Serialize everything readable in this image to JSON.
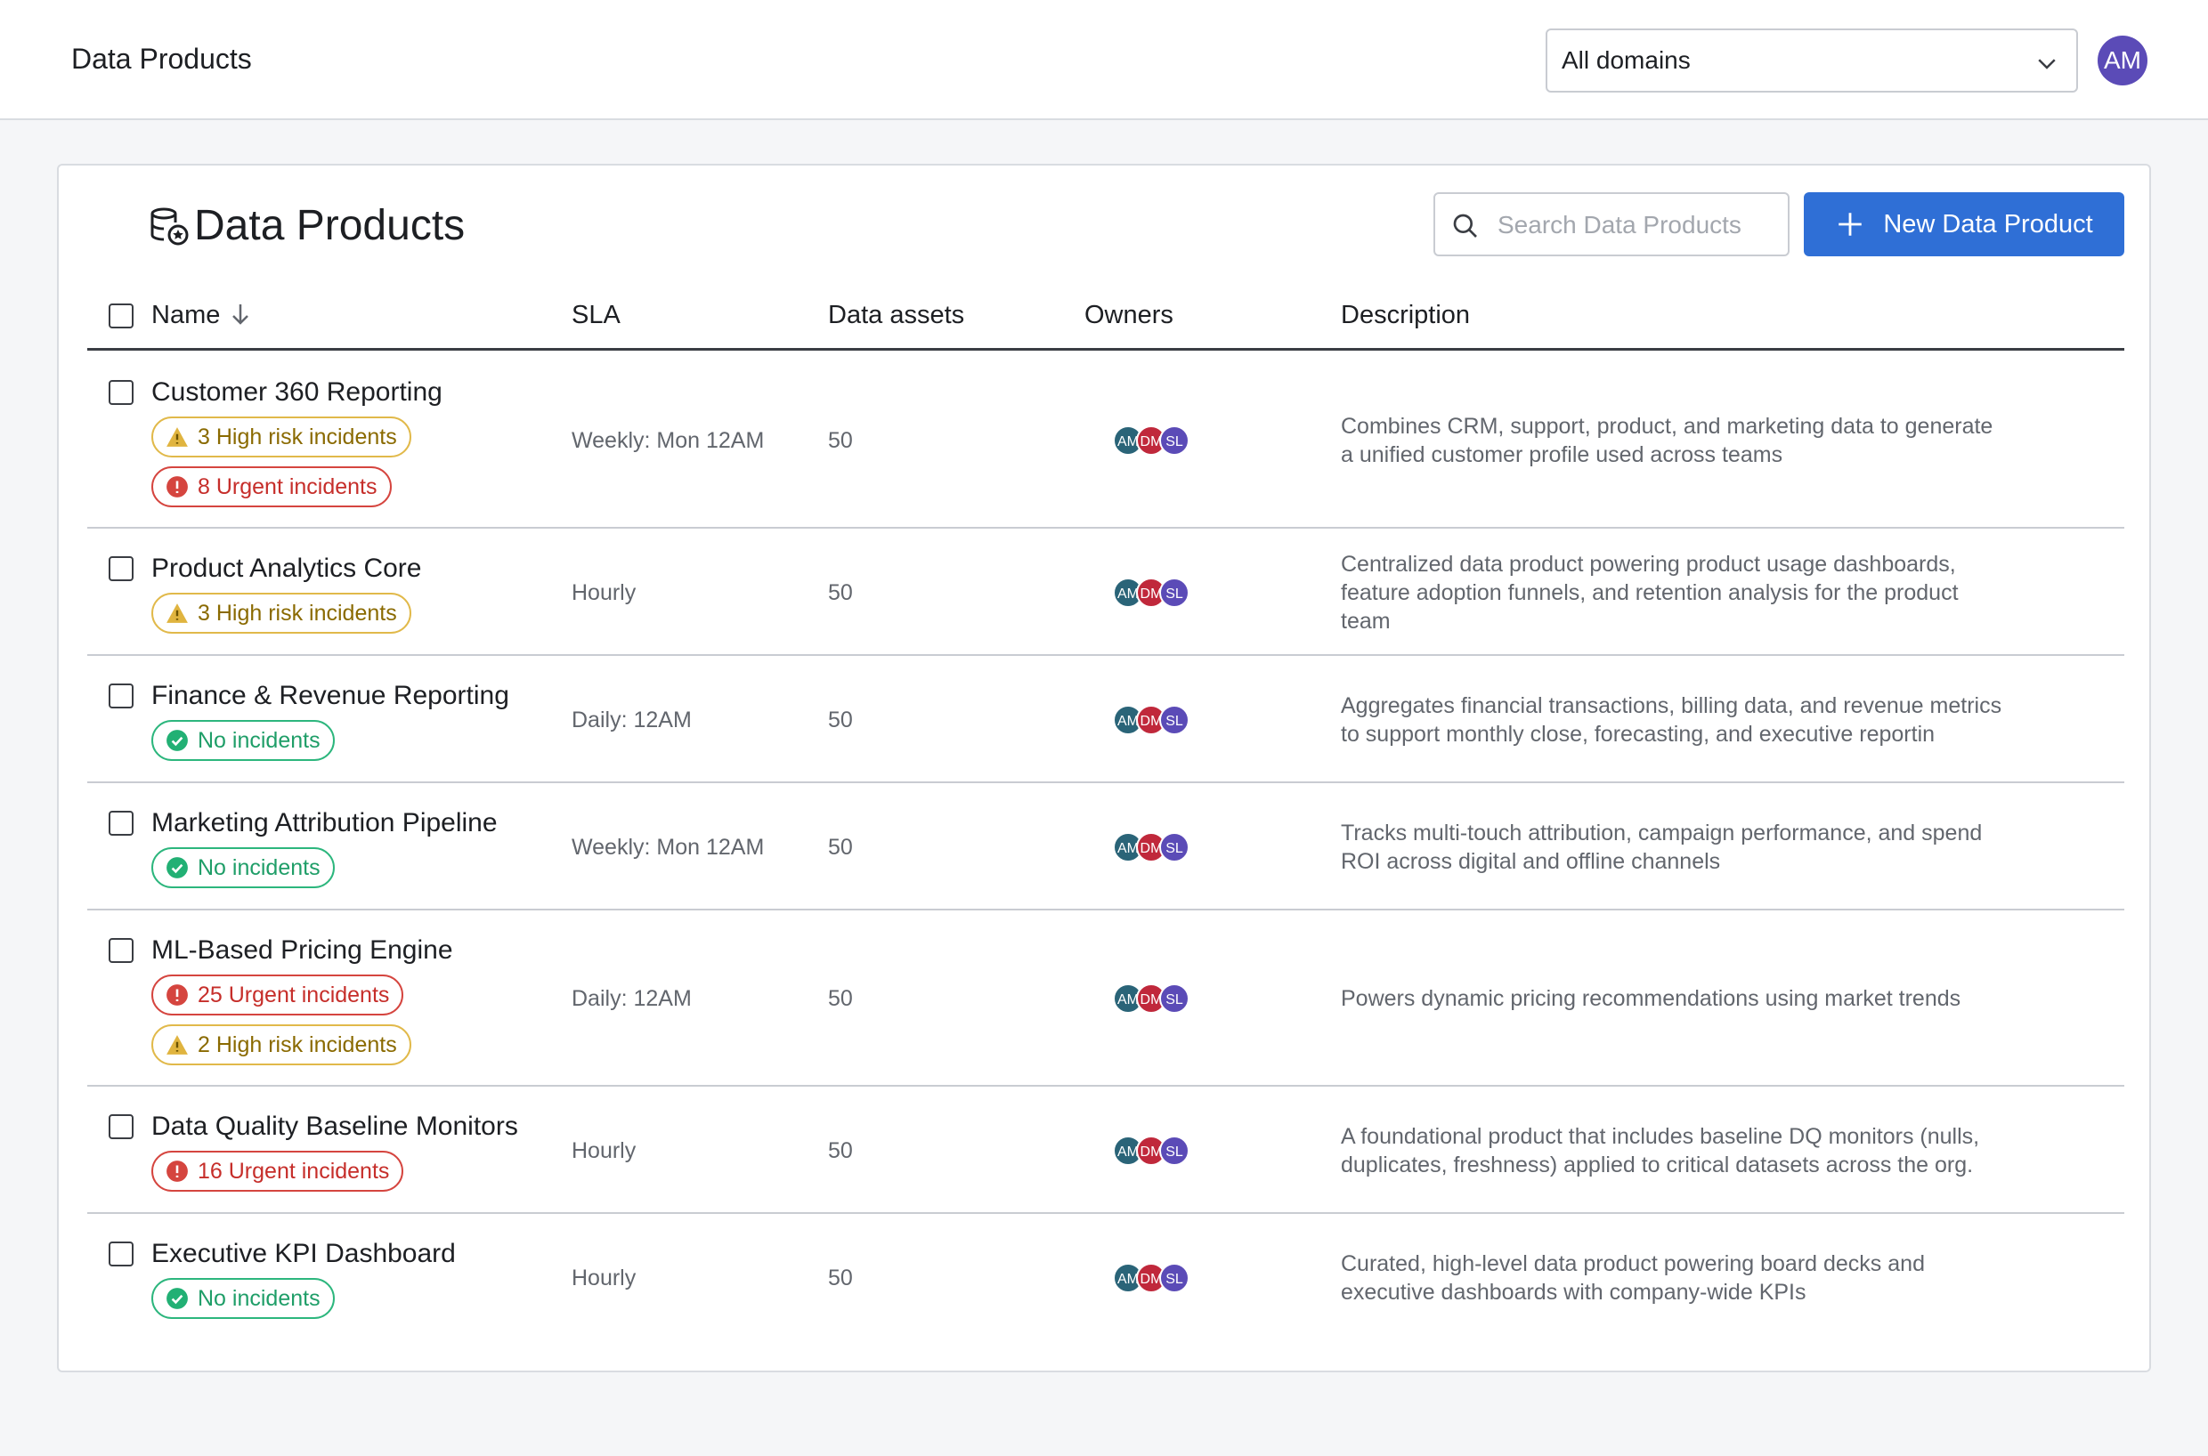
{
  "header": {
    "app_title": "Data Products",
    "domain_select": "All domains",
    "user_initials": "AM"
  },
  "card": {
    "title": "Data Products",
    "search_placeholder": "Search Data Products",
    "new_button": "New Data Product"
  },
  "table": {
    "columns": [
      "Name",
      "SLA",
      "Data assets",
      "Owners",
      "Description"
    ],
    "rows": [
      {
        "name": "Customer 360 Reporting",
        "badges": [
          {
            "type": "high",
            "label": "3 High risk incidents"
          },
          {
            "type": "urgent",
            "label": "8 Urgent incidents"
          }
        ],
        "sla": "Weekly: Mon 12AM",
        "assets": "50",
        "owners": [
          "AM",
          "DM",
          "SL"
        ],
        "description_lines": [
          "Combines CRM, support, product, and marketing data to generate",
          "a unified customer profile used across teams"
        ]
      },
      {
        "name": "Product Analytics Core",
        "badges": [
          {
            "type": "high",
            "label": "3 High risk incidents"
          }
        ],
        "sla": "Hourly",
        "assets": "50",
        "owners": [
          "AM",
          "DM",
          "SL"
        ],
        "description_lines": [
          "Centralized data product powering product usage dashboards,",
          "feature adoption funnels, and retention analysis for the product",
          "team"
        ]
      },
      {
        "name": "Finance & Revenue Reporting",
        "badges": [
          {
            "type": "none",
            "label": "No incidents"
          }
        ],
        "sla": "Daily: 12AM",
        "assets": "50",
        "owners": [
          "AM",
          "DM",
          "SL"
        ],
        "description_lines": [
          "Aggregates financial transactions, billing data, and revenue metrics",
          "to support monthly close, forecasting, and executive reportin"
        ]
      },
      {
        "name": "Marketing Attribution Pipeline",
        "badges": [
          {
            "type": "none",
            "label": "No incidents"
          }
        ],
        "sla": "Weekly: Mon 12AM",
        "assets": "50",
        "owners": [
          "AM",
          "DM",
          "SL"
        ],
        "description_lines": [
          "Tracks multi-touch attribution, campaign performance, and spend",
          "ROI across digital and offline channels"
        ]
      },
      {
        "name": "ML-Based Pricing Engine",
        "badges": [
          {
            "type": "urgent",
            "label": "25 Urgent incidents"
          },
          {
            "type": "high",
            "label": "2 High risk incidents"
          }
        ],
        "sla": "Daily: 12AM",
        "assets": "50",
        "owners": [
          "AM",
          "DM",
          "SL"
        ],
        "description_lines": [
          "Powers dynamic pricing recommendations using market trends"
        ]
      },
      {
        "name": "Data Quality Baseline Monitors",
        "badges": [
          {
            "type": "urgent",
            "label": "16 Urgent incidents"
          }
        ],
        "sla": "Hourly",
        "assets": "50",
        "owners": [
          "AM",
          "DM",
          "SL"
        ],
        "description_lines": [
          "A foundational product that includes baseline DQ monitors (nulls,",
          "duplicates, freshness) applied to critical datasets across the org."
        ]
      },
      {
        "name": "Executive KPI Dashboard",
        "badges": [
          {
            "type": "none",
            "label": "No incidents"
          }
        ],
        "sla": "Hourly",
        "assets": "50",
        "owners": [
          "AM",
          "DM",
          "SL"
        ],
        "description_lines": [
          "Curated, high-level data product powering board decks and",
          "executive dashboards with company-wide KPIs"
        ]
      }
    ]
  },
  "colors": {
    "accent": "#2f6fd6",
    "owner_am": "#2a6478",
    "owner_dm": "#c0283b",
    "owner_sl": "#5b4bb7",
    "high": "#e1b94a",
    "urgent": "#d5453f",
    "none": "#2cb67d"
  }
}
